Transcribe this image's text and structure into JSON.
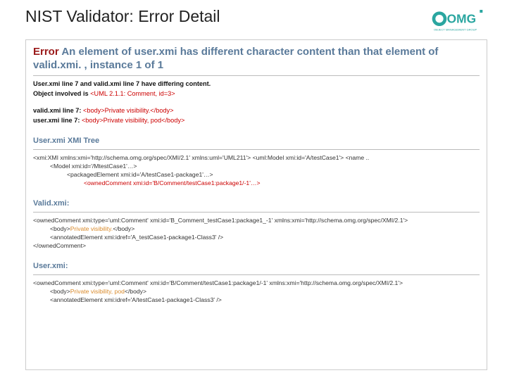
{
  "slide": {
    "title": "NIST Validator: Error Detail",
    "logo_text": "OMG",
    "logo_tagline": "OBJECT MANAGEMENT GROUP"
  },
  "error": {
    "label": "Error",
    "message": "An element of user.xmi has different character content than that element of valid.xmi. , instance 1 of 1"
  },
  "details": {
    "diff_line": "User.xmi line 7 and valid.xmi line 7 have differing content.",
    "object_label": "Object involved is ",
    "object_value": "<UML 2.1.1: Comment, id=3>",
    "valid_label": "valid.xmi line 7: ",
    "valid_value": "<body>Private visibility.</body>",
    "user_label": "user.xmi line 7: ",
    "user_value": "<body>Private visibility, pod</body>"
  },
  "tree": {
    "heading": "User.xmi XMI Tree",
    "l0": "<xmi:XMI xmlns:xmi='http://schema.omg.org/spec/XMI/2.1' xmlns:uml='UML211'> <uml:Model xmi:id='A/testCase1'> <name ..",
    "l1": "<Model xmi:id='/MtestCase1'…>",
    "l2": "<packagedElement xmi:id='A/testCase1-package1'…>",
    "l3": "<ownedComment xmi:id='B/Comment/testCase1:package1/-1'…>"
  },
  "valid_block": {
    "heading": "Valid.xmi:",
    "l0": "<ownedComment xmi:type='uml:Comment' xmi:id='B_Comment_testCase1:package1_-1' xmlns:xmi='http://schema.omg.org/spec/XMI/2.1'>",
    "l1a": "<body>",
    "l1b": "Private visibility.",
    "l1c": "</body>",
    "l2": "<annotatedElement xmi:idref='A_testCase1-package1-Class3' />",
    "l3": "</ownedComment>"
  },
  "user_block": {
    "heading": "User.xmi:",
    "l0": "<ownedComment xmi:type='uml:Comment' xmi:id='B/Comment/testCase1:package1/-1' xmlns:xmi='http://schema.omg.org/spec/XMI/2.1'>",
    "l1a": "<body>",
    "l1b": "Private visibility, pod",
    "l1c": "</body>",
    "l2": "<annotatedElement xmi:idref='A/testCase1-package1-Class3' />"
  }
}
